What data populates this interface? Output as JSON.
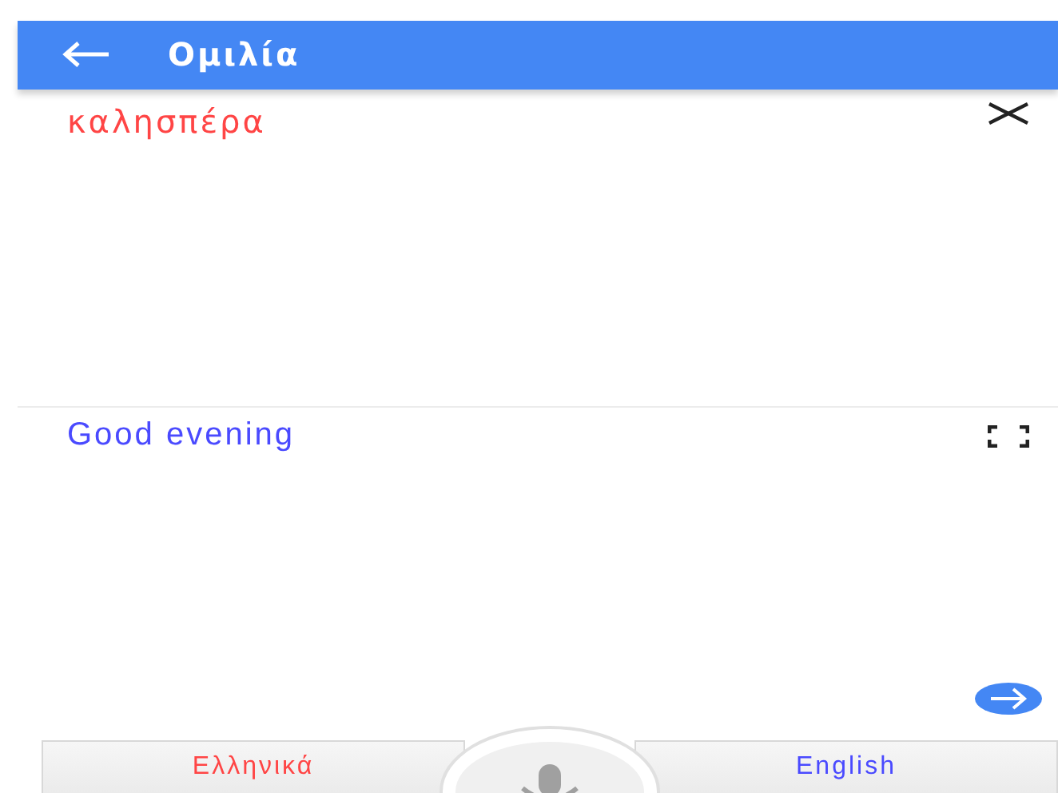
{
  "app_bar": {
    "title": "Ομιλία"
  },
  "source": {
    "text": "καλησπέρα"
  },
  "translation": {
    "text": "Good evening"
  },
  "languages": [
    {
      "label": "Ελληνικά",
      "color": "#ff4545"
    },
    {
      "label": "English",
      "color": "#4a4aff"
    }
  ]
}
